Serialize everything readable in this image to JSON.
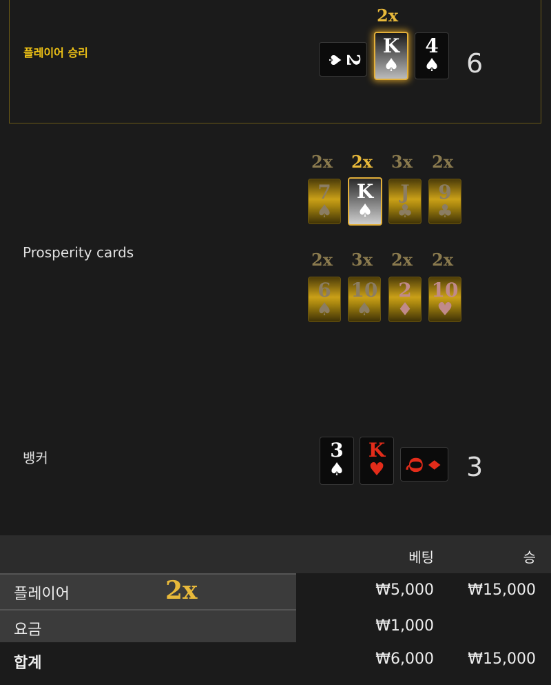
{
  "player": {
    "title": "플레이어 승리",
    "cards": [
      {
        "rank": "2",
        "suit": "♠",
        "orientation": "sideways"
      },
      {
        "rank": "K",
        "suit": "♠",
        "multiplier": "2x",
        "highlighted": true
      },
      {
        "rank": "4",
        "suit": "♠"
      }
    ],
    "score": "6"
  },
  "prosperity": {
    "label": "Prosperity cards",
    "row1": [
      {
        "multiplier": "2x",
        "rank": "7",
        "suit": "♠"
      },
      {
        "multiplier": "2x",
        "rank": "K",
        "suit": "♠",
        "selected": true
      },
      {
        "multiplier": "3x",
        "rank": "J",
        "suit": "♣"
      },
      {
        "multiplier": "2x",
        "rank": "9",
        "suit": "♣"
      }
    ],
    "row2": [
      {
        "multiplier": "2x",
        "rank": "6",
        "suit": "♠"
      },
      {
        "multiplier": "3x",
        "rank": "10",
        "suit": "♠"
      },
      {
        "multiplier": "2x",
        "rank": "2",
        "suit": "♦"
      },
      {
        "multiplier": "2x",
        "rank": "10",
        "suit": "♥"
      }
    ]
  },
  "banker": {
    "label": "뱅커",
    "cards": [
      {
        "rank": "3",
        "suit": "♠"
      },
      {
        "rank": "K",
        "suit": "♥"
      },
      {
        "rank": "Q",
        "suit": "♦",
        "orientation": "sideways"
      }
    ],
    "score": "3"
  },
  "table": {
    "header": {
      "bet": "베팅",
      "win": "승"
    },
    "rows": [
      {
        "label": "플레이어",
        "multiplier": "2x",
        "bet": "₩5,000",
        "win": "₩15,000"
      },
      {
        "label": "요금",
        "bet": "₩1,000",
        "win": ""
      }
    ],
    "total": {
      "label": "합계",
      "bet": "₩6,000",
      "win": "₩15,000"
    }
  },
  "colors": {
    "gold": "#e8b93a",
    "title_yellow": "#f2c515",
    "red_suit": "#e32c1a"
  }
}
